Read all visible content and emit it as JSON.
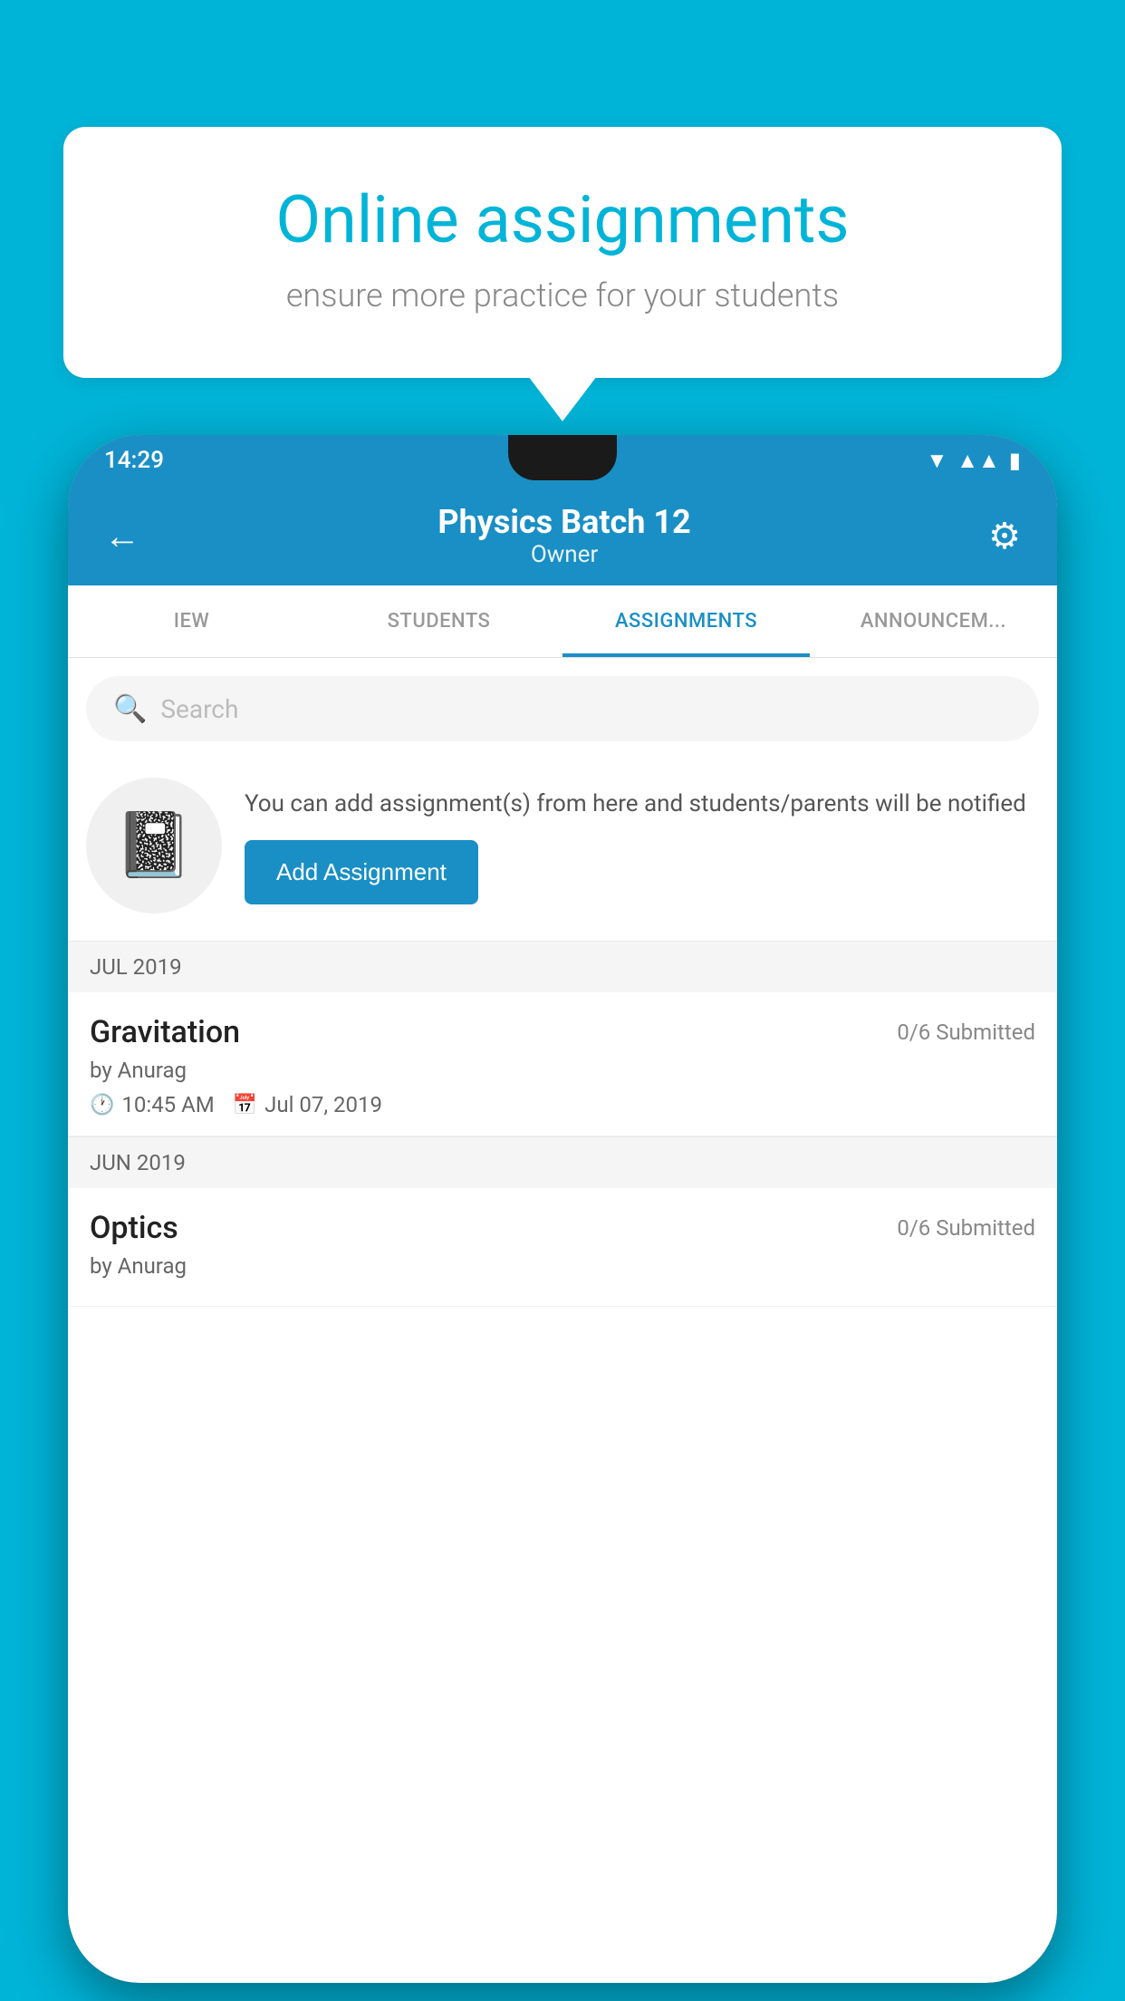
{
  "background_color": "#00b4d8",
  "speech_bubble": {
    "title": "Online assignments",
    "subtitle": "ensure more practice for your students"
  },
  "status_bar": {
    "time": "14:29",
    "wifi": "▲",
    "signal": "▲",
    "battery": "▮"
  },
  "app_bar": {
    "title": "Physics Batch 12",
    "subtitle": "Owner",
    "back_icon": "←",
    "settings_icon": "⚙"
  },
  "tabs": [
    {
      "label": "IEW",
      "active": false
    },
    {
      "label": "STUDENTS",
      "active": false
    },
    {
      "label": "ASSIGNMENTS",
      "active": true
    },
    {
      "label": "ANNOUNCEM...",
      "active": false
    }
  ],
  "search": {
    "placeholder": "Search"
  },
  "promo": {
    "text": "You can add assignment(s) from here and students/parents will be notified",
    "button_label": "Add Assignment"
  },
  "sections": [
    {
      "header": "JUL 2019",
      "assignments": [
        {
          "title": "Gravitation",
          "submitted": "0/6 Submitted",
          "by": "by Anurag",
          "time": "10:45 AM",
          "date": "Jul 07, 2019"
        }
      ]
    },
    {
      "header": "JUN 2019",
      "assignments": [
        {
          "title": "Optics",
          "submitted": "0/6 Submitted",
          "by": "by Anurag",
          "time": "",
          "date": ""
        }
      ]
    }
  ]
}
